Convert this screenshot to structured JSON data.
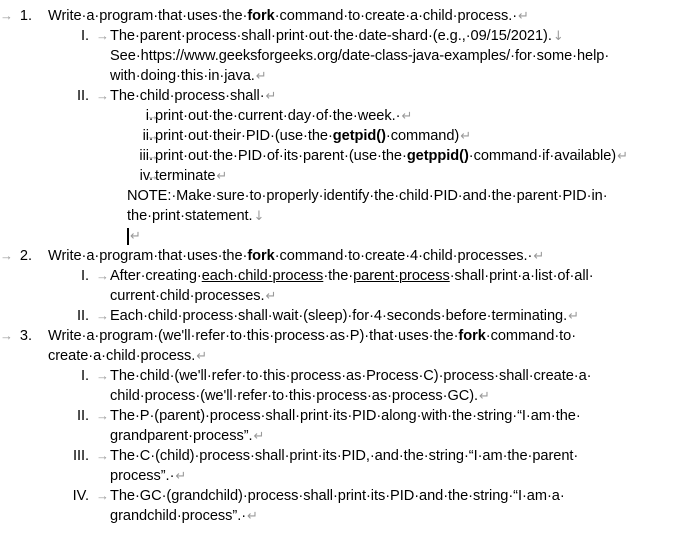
{
  "document": {
    "formatting_marks_visible": true,
    "mark_color": "#9a9a9a",
    "text_color": "#000000",
    "background": "#ffffff",
    "marks": {
      "space": "·",
      "tab": "→",
      "paragraph": "↵",
      "line_break": "↓"
    },
    "caret": {
      "visible": true,
      "line": "empty-line-after-note"
    },
    "items": [
      {
        "level": 1,
        "marker": "1.",
        "lines": [
          "Write a program that uses the fork command to create a child process.",
          ""
        ]
      }
    ]
  },
  "content": {
    "item1": {
      "marker": "1.",
      "text_a": "Write·a·program·that·uses·the·",
      "bold": "fork",
      "text_b": "·command·to·create·a·child·process.·"
    },
    "item1_I": {
      "marker": "I.",
      "line1": "The·parent·process·shall·print·out·the·date-shard·(e.g.,·09/15/2021).",
      "line2": "See·https://www.geeksforgeeks.org/date-class-java-examples/·for·some·help·",
      "line3": "with·doing·this·in·java."
    },
    "item1_II": {
      "marker": "II.",
      "line1": "The·child·process·shall·"
    },
    "item1_II_i": {
      "marker": "i.",
      "text": "print·out·the·current·day·of·the·week.·"
    },
    "item1_II_ii": {
      "marker": "ii.",
      "text_a": "print·out·their·PID·(use·the·",
      "bold": "getpid()",
      "text_b": "·command)"
    },
    "item1_II_iii": {
      "marker": "iii.",
      "text_a": "print·out·the·PID·of·its·parent·(use·the·",
      "bold": "getppid()",
      "text_b": "·command·if·available)"
    },
    "item1_II_iv": {
      "marker": "iv.",
      "text": "terminate"
    },
    "note": {
      "line1": "NOTE:·Make·sure·to·properly·identify·the·child·PID·and·the·parent·PID·in·",
      "line2": "the·print·statement."
    },
    "item2": {
      "marker": "2.",
      "text_a": "Write·a·program·that·uses·the·",
      "bold": "fork",
      "text_b": "·command·to·create·4·child·processes.·"
    },
    "item2_I": {
      "marker": "I.",
      "line1_a": "After·creating·",
      "line1_u1": "each·child·process",
      "line1_b": "·the·",
      "line1_u2": "parent·process",
      "line1_c": "·shall·print·a·list·of·all·",
      "line2": "current·child·processes."
    },
    "item2_II": {
      "marker": "II.",
      "text": "Each·child·process·shall·wait·(sleep)·for·4·seconds·before·terminating."
    },
    "item3": {
      "marker": "3.",
      "line1_a": "Write·a·program·(we'll·refer·to·this·process·as·P)·that·uses·the·",
      "bold": "fork",
      "line1_b": "·command·to·",
      "line2": "create·a·child·process."
    },
    "item3_I": {
      "marker": "I.",
      "line1": "The·child·(we'll·refer·to·this·process·as·Process·C)·process·shall·create·a·",
      "line2": "child·process·(we'll·refer·to·this·process·as·process·GC)."
    },
    "item3_II": {
      "marker": "II.",
      "line1": "The·P·(parent)·process·shall·print·its·PID·along·with·the·string·“I·am·the·",
      "line2": "grandparent·process”."
    },
    "item3_III": {
      "marker": "III.",
      "line1": "The·C·(child)·process·shall·print·its·PID,·and·the·string·“I·am·the·parent·",
      "line2": "process”.·"
    },
    "item3_IV": {
      "marker": "IV.",
      "line1": "The·GC·(grandchild)·process·shall·print·its·PID·and·the·string·“I·am·a·",
      "line2": "grandchild·process”.·"
    }
  }
}
